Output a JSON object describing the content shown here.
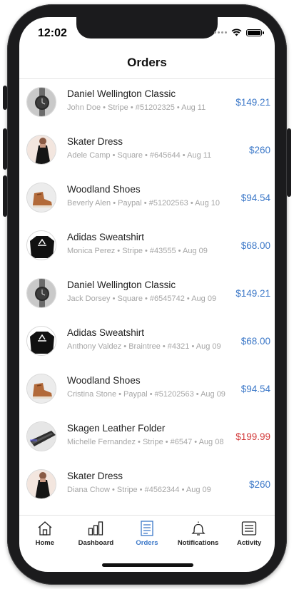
{
  "status": {
    "time": "12:02"
  },
  "header": {
    "title": "Orders"
  },
  "orders": [
    {
      "product": "Daniel Wellington Classic",
      "meta": "John Doe • Stripe • #51202325 • Aug 11",
      "price": "$149.21",
      "status_color": "#3c78c8",
      "image": "watch"
    },
    {
      "product": "Skater Dress",
      "meta": "Adele Camp • Square • #645644 • Aug 11",
      "price": "$260",
      "status_color": "#3c78c8",
      "image": "dress"
    },
    {
      "product": "Woodland Shoes",
      "meta": "Beverly Alen • Paypal • #51202563 • Aug 10",
      "price": "$94.54",
      "status_color": "#3c78c8",
      "image": "shoe"
    },
    {
      "product": "Adidas Sweatshirt",
      "meta": "Monica Perez • Stripe • #43555 • Aug 09",
      "price": "$68.00",
      "status_color": "#3c78c8",
      "image": "sweatshirt"
    },
    {
      "product": "Daniel Wellington Classic",
      "meta": "Jack Dorsey • Square • #6545742 • Aug 09",
      "price": "$149.21",
      "status_color": "#3c78c8",
      "image": "watch"
    },
    {
      "product": "Adidas Sweatshirt",
      "meta": "Anthony Valdez • Braintree • #4321 • Aug 09",
      "price": "$68.00",
      "status_color": "#3c78c8",
      "image": "sweatshirt"
    },
    {
      "product": "Woodland Shoes",
      "meta": "Cristina Stone • Paypal • #51202563 • Aug 09",
      "price": "$94.54",
      "status_color": "#3c78c8",
      "image": "shoe"
    },
    {
      "product": "Skagen Leather Folder",
      "meta": "Michelle Fernandez • Stripe • #6547 • Aug 08",
      "price": "$199.99",
      "status_color": "#d23a3a",
      "image": "folder"
    },
    {
      "product": "Skater Dress",
      "meta": "Diana Chow • Stripe • #4562344 • Aug 09",
      "price": "$260",
      "status_color": "#3c78c8",
      "image": "dress"
    }
  ],
  "tabbar": {
    "active": "Orders",
    "active_color": "#3c78c8",
    "items": [
      {
        "label": "Home",
        "icon": "home-icon"
      },
      {
        "label": "Dashboard",
        "icon": "bar-chart-icon"
      },
      {
        "label": "Orders",
        "icon": "list-document-icon"
      },
      {
        "label": "Notifications",
        "icon": "bell-icon"
      },
      {
        "label": "Activity",
        "icon": "menu-lines-icon"
      }
    ]
  }
}
